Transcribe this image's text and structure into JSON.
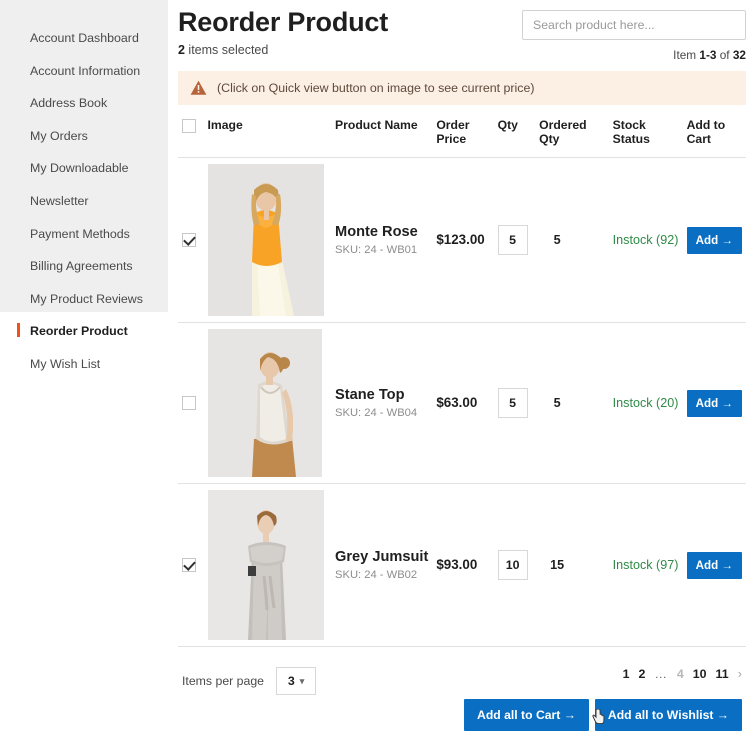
{
  "sidebar": {
    "items": [
      {
        "label": "Account Dashboard",
        "active": false
      },
      {
        "label": "Account Information",
        "active": false
      },
      {
        "label": "Address Book",
        "active": false
      },
      {
        "label": "My Orders",
        "active": false
      },
      {
        "label": "My Downloadable",
        "active": false
      },
      {
        "label": "Newsletter",
        "active": false
      },
      {
        "label": "Payment Methods",
        "active": false
      },
      {
        "label": "Billing Agreements",
        "active": false
      },
      {
        "label": "My Product Reviews",
        "active": false
      },
      {
        "label": "Reorder Product",
        "active": true
      },
      {
        "label": "My Wish List",
        "active": false
      }
    ]
  },
  "header": {
    "title": "Reorder Product",
    "selected_count": "2",
    "selected_suffix": " items selected",
    "item_count_prefix": "Item ",
    "item_count_range": "1-3",
    "item_count_middle": " of ",
    "item_count_total": "32"
  },
  "search": {
    "placeholder": "Search product here...",
    "value": ""
  },
  "alert": {
    "icon": "warning-triangle-icon",
    "text": "(Click on Quick view button on image to see current price)",
    "background": "#fcefe3",
    "icon_color": "#b5643c",
    "text_color": "#5d4a3c"
  },
  "table": {
    "headers": {
      "select_all": "",
      "image": "Image",
      "product_name": "Product Name",
      "order_price": "Order Price",
      "qty": "Qty",
      "ordered_qty": "Ordered Qty",
      "stock_status_line1": "Stock",
      "stock_status_line2": "Status",
      "add_to_cart_line1": "Add to",
      "add_to_cart_line2": "Cart"
    },
    "select_all_checked": false,
    "rows": [
      {
        "checked": true,
        "name": "Monte Rose",
        "sku": "SKU: 24 - WB01",
        "price": "$123.00",
        "qty": "5",
        "ordered_qty": "5",
        "stock": "Instock (92)",
        "add_label": "Add →"
      },
      {
        "checked": false,
        "name": "Stane Top",
        "sku": "SKU: 24 - WB04",
        "price": "$63.00",
        "qty": "5",
        "ordered_qty": "5",
        "stock": "Instock (20)",
        "add_label": "Add →"
      },
      {
        "checked": true,
        "name": "Grey Jumsuit",
        "sku": "SKU: 24 - WB02",
        "price": "$93.00",
        "qty": "10",
        "ordered_qty": "15",
        "stock": "Instock (97)",
        "add_label": "Add →"
      }
    ]
  },
  "footer": {
    "items_per_page_label": "Items per page",
    "items_per_page_value": "3",
    "pagination": [
      {
        "label": "1",
        "state": "active"
      },
      {
        "label": "2",
        "state": "active"
      },
      {
        "label": "…",
        "state": "dots"
      },
      {
        "label": "4",
        "state": "dim"
      },
      {
        "label": "10",
        "state": "active"
      },
      {
        "label": "11",
        "state": "active"
      }
    ],
    "next_label": "›",
    "add_all_cart_label": "Add all to Cart →",
    "add_all_wishlist_label": "Add all to Wishlist →"
  },
  "colors": {
    "accent_blue": "#0a6fc2",
    "active_bar_orange": "#f2511b",
    "stock_green": "#2e8b46",
    "sidebar_bg": "#efefef"
  }
}
